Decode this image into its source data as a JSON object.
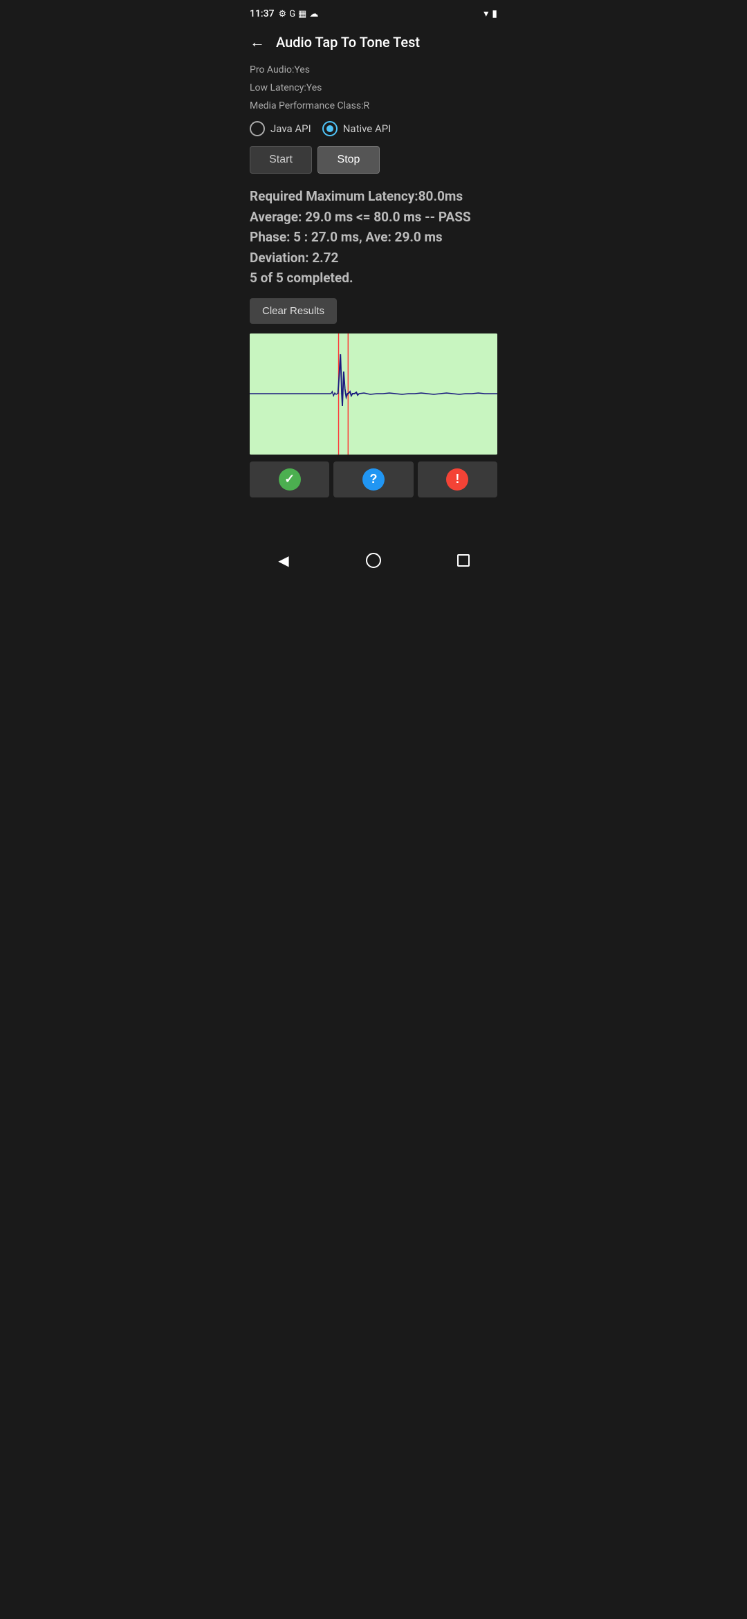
{
  "statusBar": {
    "time": "11:37",
    "icons": [
      "♻",
      "G",
      "📅",
      "☁"
    ]
  },
  "appBar": {
    "title": "Audio Tap To Tone Test",
    "backLabel": "←"
  },
  "deviceInfo": {
    "proAudio": "Pro Audio:Yes",
    "lowLatency": "Low Latency:Yes",
    "mediaPerformance": "Media Performance Class:R"
  },
  "radioGroup": {
    "options": [
      "Java API",
      "Native API"
    ],
    "selected": "Native API"
  },
  "buttons": {
    "start": "Start",
    "stop": "Stop"
  },
  "results": {
    "line1": "Required Maximum Latency:80.0ms",
    "line2": "Average: 29.0 ms <= 80.0 ms -- PASS",
    "line3": "Phase: 5 : 27.0 ms, Ave: 29.0 ms",
    "line4": "Deviation: 2.72",
    "line5": "5 of 5 completed.",
    "clearLabel": "Clear Results"
  },
  "bottomActions": {
    "pass": "✓",
    "question": "?",
    "warning": "!"
  },
  "navBar": {
    "back": "◀",
    "home": "",
    "recent": ""
  }
}
